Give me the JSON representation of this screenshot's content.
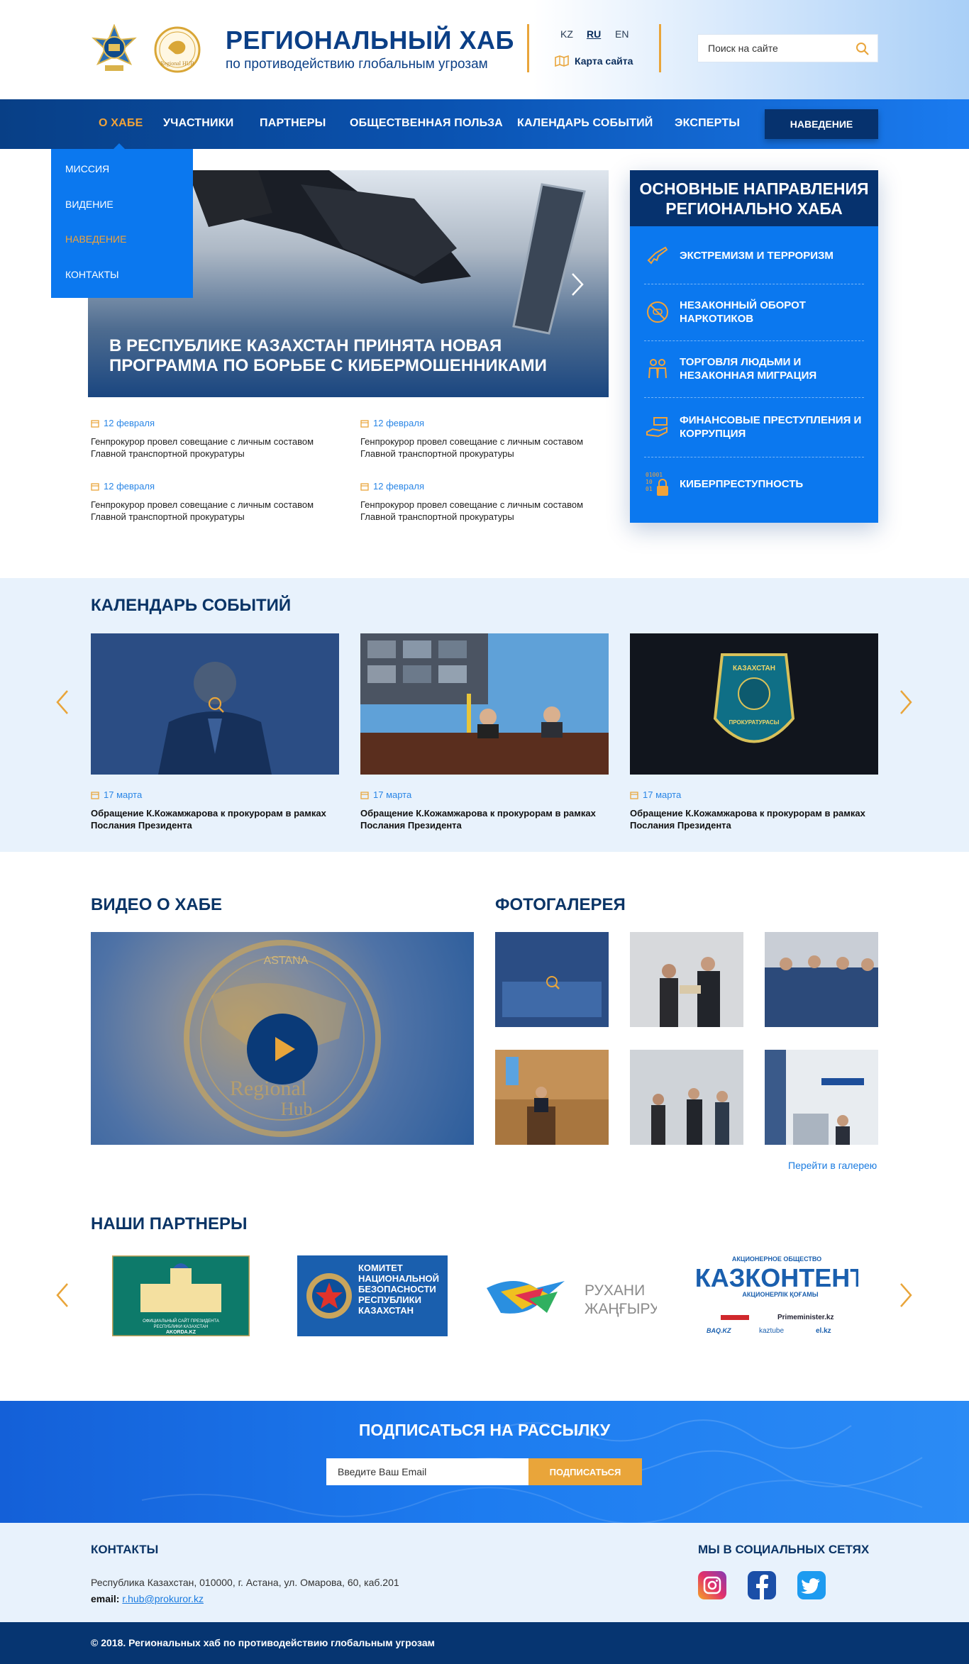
{
  "header": {
    "title": "РЕГИОНАЛЬНЫЙ ХАБ",
    "subtitle": "по противодействию глобальным угрозам",
    "emblem2_text": "Regional HUB",
    "languages": [
      "KZ",
      "RU",
      "EN"
    ],
    "active_language": "RU",
    "sitemap_label": "Карта сайта",
    "search_placeholder": "Поиск на сайте"
  },
  "nav": {
    "items": [
      "О ХАБЕ",
      "УЧАСТНИКИ",
      "ПАРТНЕРЫ",
      "ОБЩЕСТВЕННАЯ ПОЛЬЗА",
      "КАЛЕНДАРЬ СОБЫТИЙ",
      "ЭКСПЕРТЫ"
    ],
    "active_item": "О ХАБЕ",
    "button_label": "НАВЕДЕНИЕ",
    "dropdown": [
      "МИССИЯ",
      "ВИДЕНИЕ",
      "НАВЕДЕНИЕ",
      "КОНТАКТЫ"
    ],
    "dropdown_active": "НАВЕДЕНИЕ"
  },
  "hero": {
    "caption": "В РЕСПУБЛИКЕ КАЗАХСТАН ПРИНЯТА НОВАЯ ПРОГРАММА ПО БОРЬБЕ С КИБЕРМОШЕННИКАМИ"
  },
  "news": [
    {
      "date": "12 февраля",
      "text": "Генпрокурор провел совещание с личным составом Главной транспортной прокуратуры"
    },
    {
      "date": "12 февраля",
      "text": "Генпрокурор провел совещание с личным составом Главной транспортной прокуратуры"
    },
    {
      "date": "12 февраля",
      "text": "Генпрокурор провел совещание с личным составом Главной транспортной прокуратуры"
    },
    {
      "date": "12 февраля",
      "text": "Генпрокурор провел совещание с личным составом Главной транспортной прокуратуры"
    }
  ],
  "directions": {
    "title": "ОСНОВНЫЕ НАПРАВЛЕНИЯ РЕГИОНАЛЬНО ХАБА",
    "items": [
      {
        "label": "ЭКСТРЕМИЗМ И ТЕРРОРИЗМ",
        "icon": "gun-icon"
      },
      {
        "label": "НЕЗАКОННЫЙ ОБОРОТ НАРКОТИКОВ",
        "icon": "no-drugs-icon"
      },
      {
        "label": "ТОРГОВЛЯ ЛЮДЬМИ И НЕЗАКОННАЯ МИГРАЦИЯ",
        "icon": "people-icon"
      },
      {
        "label": "ФИНАНСОВЫЕ ПРЕСТУПЛЕНИЯ И КОРРУПЦИЯ",
        "icon": "money-hand-icon"
      },
      {
        "label": "КИБЕРПРЕСТУПНОСТЬ",
        "icon": "binary-lock-icon"
      }
    ]
  },
  "calendar": {
    "title": "КАЛЕНДАРЬ СОБЫТИЙ",
    "events": [
      {
        "date": "17 марта",
        "text": "Обращение К.Кожамжарова к прокурорам в рамках Послания Президента"
      },
      {
        "date": "17 марта",
        "text": "Обращение К.Кожамжарова к прокурорам в рамках Послания Президента"
      },
      {
        "date": "17 марта",
        "text": "Обращение К.Кожамжарова к прокурорам в рамках Послания Президента"
      }
    ],
    "badge_line1": "КАЗАХСТАН",
    "badge_line2": "ПРОКУРАТУРАСЫ"
  },
  "video": {
    "title": "ВИДЕО О ХАБЕ",
    "overlay_top": "ASTANA",
    "overlay_line1": "Regional",
    "overlay_line2": "Hub"
  },
  "gallery": {
    "title": "ФОТОГАЛЕРЕЯ",
    "link": "Перейти в галерею"
  },
  "partners": {
    "title": "НАШИ ПАРТНЕРЫ",
    "akorda_caption_1": "ОФИЦИАЛЬНЫЙ САЙТ ПРЕЗИДЕНТА",
    "akorda_caption_2": "РЕСПУБЛИКИ КАЗАХСТАН",
    "akorda_caption_3": "AKORDA.KZ",
    "knb_text": "КОМИТЕТ НАЦИОНАЛЬНОЙ БЕЗОПАСНОСТИ РЕСПУБЛИКИ КАЗАХСТАН",
    "rukhani_1": "РУХАНИ",
    "rukhani_2": "ЖАҢҒЫРУ",
    "kazcontent_top": "АКЦИОНЕРНОЕ ОБЩЕСТВО",
    "kazcontent_name": "КАЗКОНТЕНТ",
    "kazcontent_sub": "АКЦИОНЕРЛІК ҚОҒАМЫ",
    "kazcontent_links": [
      "Primeminister.kz",
      "BAQ.KZ",
      "kaztube",
      "el.kz"
    ]
  },
  "subscribe": {
    "title": "ПОДПИСАТЬСЯ НА РАССЫЛКУ",
    "placeholder": "Введите Ваш Email",
    "button": "ПОДПИСАТЬСЯ"
  },
  "footer": {
    "contacts_title": "КОНТАКТЫ",
    "address": "Республика Казахстан, 010000, г. Астана, ул. Омарова, 60, каб.201",
    "email_label": "email:",
    "email": "r.hub@prokuror.kz",
    "social_title": "МЫ В СОЦИАЛЬНЫХ СЕТЯХ",
    "copyright": "© 2018. Региональных хаб по противодействию глобальным угрозам"
  },
  "colors": {
    "navy": "#063571",
    "blue": "#0b78ef",
    "accent": "#e9a53a"
  }
}
